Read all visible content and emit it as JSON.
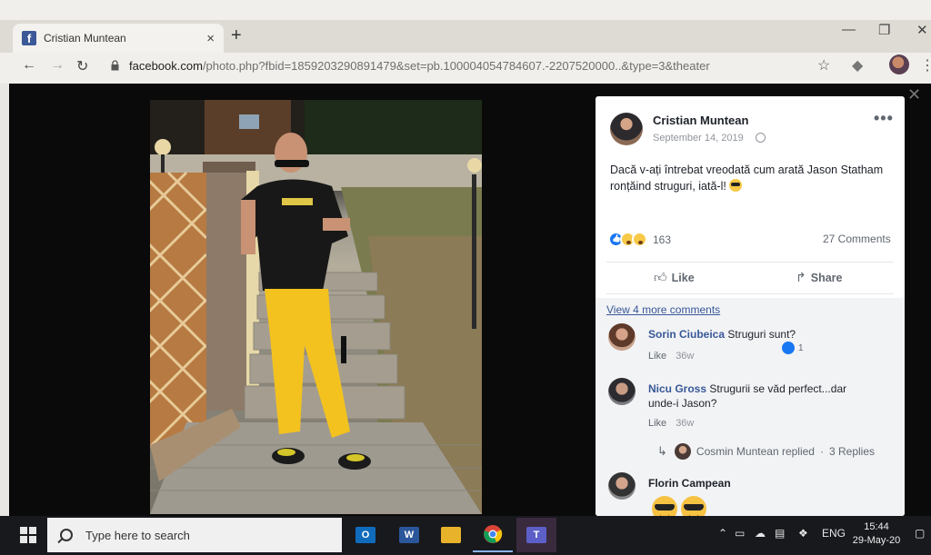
{
  "browser": {
    "tab_title": "Cristian Muntean",
    "tab_close": "×",
    "new_tab": "+",
    "url_host": "facebook.com",
    "url_path": "/photo.php?fbid=1859203290891479&set=pb.100004054784607.-2207520000..&type=3&theater",
    "window_controls": [
      "—",
      "❐",
      "✕"
    ]
  },
  "post": {
    "author": "Cristian Muntean",
    "date": "September 14, 2019",
    "more": "•••",
    "text": "Dacă v-ați întrebat vreodată cum arată Jason Statham ronțăind struguri, iată-l!",
    "reaction_count": "163",
    "comments_count": "27 Comments",
    "like_label": "Like",
    "share_label": "Share"
  },
  "comments": {
    "view_more": "View 4 more comments",
    "items": [
      {
        "name": "Sorin Ciubeica",
        "text": "Struguri sunt?",
        "like": "Like",
        "age": "36w",
        "likes": "1"
      },
      {
        "name": "Nicu Gross",
        "text": "Strugurii se văd perfect...dar unde-i Jason?",
        "like": "Like",
        "age": "36w"
      },
      {
        "name": "Florin Campean",
        "text": ""
      }
    ],
    "reply": {
      "name": "Cosmin Muntean replied",
      "sep": "·",
      "count": "3 Replies"
    }
  },
  "taskbar": {
    "search_placeholder": "Type here to search",
    "apps": [
      {
        "name": "Outlook",
        "letter": "O",
        "color": "#0f6cbd"
      },
      {
        "name": "Word",
        "letter": "W",
        "color": "#2b579a"
      },
      {
        "name": "File Explorer",
        "letter": "",
        "color": "#e8b32a"
      },
      {
        "name": "Chrome",
        "letter": "",
        "color": "#db4437"
      },
      {
        "name": "Teams",
        "letter": "T",
        "color": "#5b5fc7"
      }
    ],
    "language": "ENG",
    "time": "15:44",
    "date": "29-May-20"
  },
  "colors": {
    "facebook_blue": "#385898",
    "theater_bg": "#0a0a0a",
    "taskbar_bg": "#18191d"
  }
}
